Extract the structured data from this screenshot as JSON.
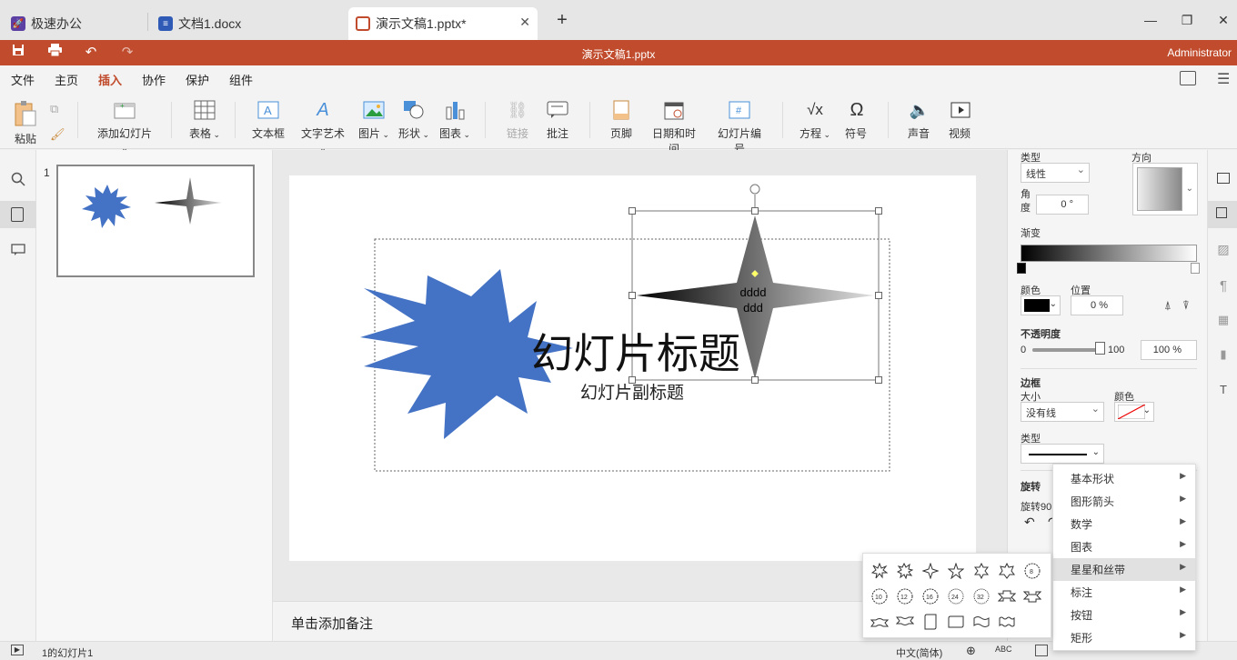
{
  "tabs": [
    {
      "label": "极速办公",
      "icon": "rocket-icon"
    },
    {
      "label": "文档1.docx",
      "icon": "doc-icon"
    },
    {
      "label": "演示文稿1.pptx*",
      "icon": "ppt-icon"
    }
  ],
  "window": {
    "title": "演示文稿1.pptx",
    "user": "Administrator"
  },
  "menu": [
    "文件",
    "主页",
    "插入",
    "协作",
    "保护",
    "组件"
  ],
  "ribbon": {
    "paste": "粘贴",
    "add_slide": "添加幻灯片",
    "table": "表格",
    "textbox": "文本框",
    "wordart": "文字艺术",
    "picture": "图片",
    "shape": "形状",
    "chart": "图表",
    "link": "链接",
    "comment": "批注",
    "footer": "页脚",
    "datetime": "日期和时间",
    "slide_number": "幻灯片编号",
    "equation": "方程",
    "symbol": "符号",
    "audio": "声音",
    "video": "视频"
  },
  "thumbnail": {
    "number": "1"
  },
  "slide": {
    "title": "幻灯片标题",
    "subtitle": "幻灯片副标题",
    "shape_text_1": "dddd",
    "shape_text_2": "ddd"
  },
  "notes": {
    "placeholder": "单击添加备注"
  },
  "panel": {
    "type_label": "类型",
    "type_value": "线性",
    "direction_label": "方向",
    "angle_label_1": "角",
    "angle_label_2": "度",
    "angle_value": "0 °",
    "gradient_label": "渐变",
    "color_label": "颜色",
    "position_label": "位置",
    "position_value": "0 %",
    "opacity_label": "不透明度",
    "opacity_min": "0",
    "opacity_max": "100",
    "opacity_value": "100 %",
    "opacity_level": 1.0,
    "border_label": "边框",
    "size_label": "大小",
    "size_value": "没有线",
    "border_color_label": "颜色",
    "border_type_label": "类型",
    "rotate_label": "旋转",
    "rotate90_label": "旋转90"
  },
  "context_menu": [
    {
      "label": "基本形状"
    },
    {
      "label": "图形箭头"
    },
    {
      "label": "数学"
    },
    {
      "label": "图表"
    },
    {
      "label": "星星和丝带",
      "highlighted": true
    },
    {
      "label": "标注"
    },
    {
      "label": "按钮"
    },
    {
      "label": "矩形"
    }
  ],
  "star_labels": [
    "10",
    "12",
    "16",
    "24",
    "32",
    "8"
  ],
  "status": {
    "slide_info": "1的幻灯片1",
    "language": "中文(简体)"
  },
  "colors": {
    "accent": "#c14c2d",
    "shape_blue": "#4472c4"
  }
}
